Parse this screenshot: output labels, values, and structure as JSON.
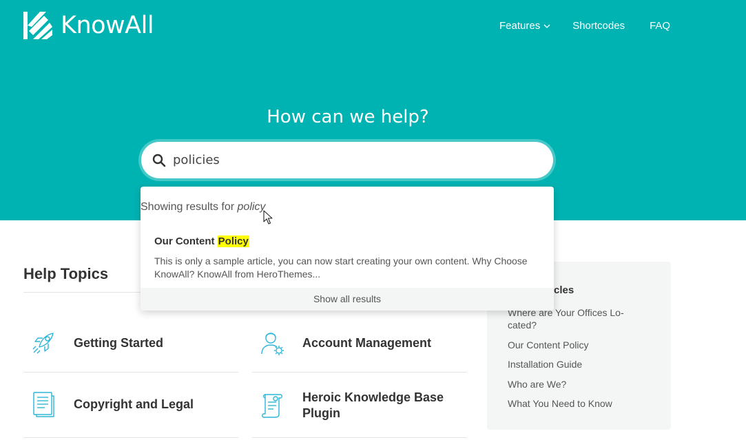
{
  "brand": {
    "name": "KnowAll"
  },
  "nav": {
    "features": "Features",
    "shortcodes": "Shortcodes",
    "faq": "FAQ"
  },
  "hero": {
    "title": "How can we help?"
  },
  "search": {
    "value": "policies"
  },
  "dropdown": {
    "showing_prefix": "Showing results for ",
    "showing_term": "policy",
    "result": {
      "title_prefix": "Our Content ",
      "title_highlight": "Policy",
      "excerpt": "This is only a sample article, you can now start creating your own content. Why Choose KnowAll? KnowAll from HeroThemes..."
    },
    "show_all": "Show all results"
  },
  "help_topics": {
    "title": "Help Topics",
    "items": [
      {
        "label": "Getting Started",
        "icon": "rocket-icon"
      },
      {
        "label": "Account Management",
        "icon": "user-gear-icon"
      },
      {
        "label": "Copyright and Legal",
        "icon": "document-icon"
      },
      {
        "label": "Heroic Knowledge Base Plugin",
        "icon": "scroll-icon"
      }
    ]
  },
  "sidebar": {
    "title_visible": "rticles",
    "articles": [
      "Where are Your Offices Lo-cated?",
      "Our Content Policy",
      "Installation Guide",
      "Who are We?",
      "What You Need to Know"
    ]
  },
  "colors": {
    "hero_bg": "#00b3b3",
    "highlight": "#ffff00",
    "icon_accent": "#2cb5d8"
  }
}
